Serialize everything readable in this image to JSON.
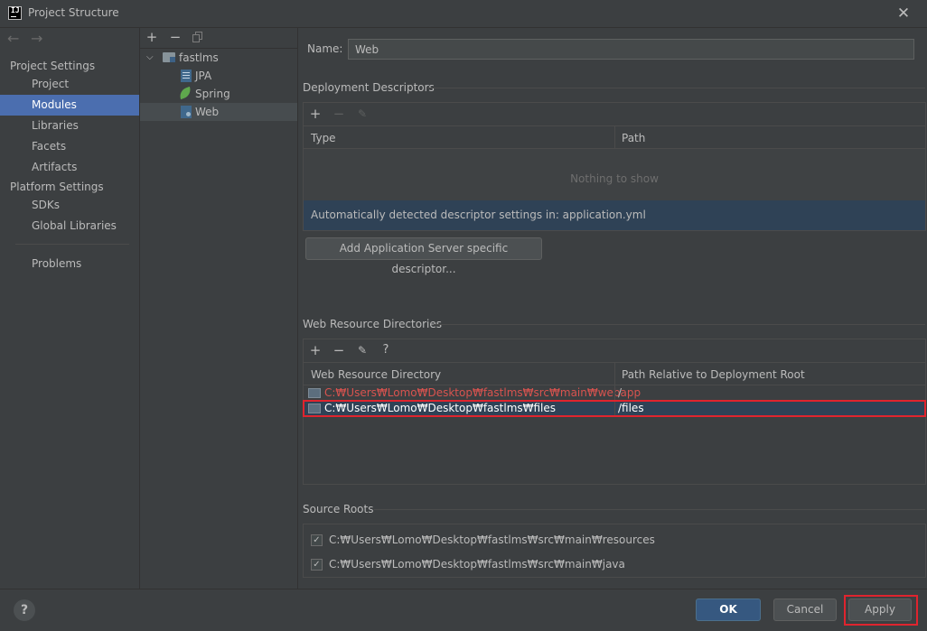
{
  "window": {
    "title": "Project Structure"
  },
  "nav": {
    "project_settings_header": "Project Settings",
    "project_settings_items": [
      "Project",
      "Modules",
      "Libraries",
      "Facets",
      "Artifacts"
    ],
    "platform_settings_header": "Platform Settings",
    "platform_settings_items": [
      "SDKs",
      "Global Libraries"
    ],
    "problems": "Problems",
    "selected": "Modules"
  },
  "tree": {
    "root": "fastlms",
    "children": [
      "JPA",
      "Spring",
      "Web"
    ],
    "selected": "Web"
  },
  "editor": {
    "name_label": "Name:",
    "name_value": "Web",
    "deployment": {
      "title": "Deployment Descriptors",
      "col_type": "Type",
      "col_path": "Path",
      "empty_text": "Nothing to show",
      "info": "Automatically detected descriptor settings in: application.yml",
      "add_button": "Add Application Server specific descriptor..."
    },
    "web_resources": {
      "title": "Web Resource Directories",
      "col_dir": "Web Resource Directory",
      "col_path": "Path Relative to Deployment Root",
      "rows": [
        {
          "dir": "C:₩Users₩Lomo₩Desktop₩fastlms₩src₩main₩webapp",
          "path": "/"
        },
        {
          "dir": "C:₩Users₩Lomo₩Desktop₩fastlms₩files",
          "path": "/files"
        }
      ]
    },
    "source_roots": {
      "title": "Source Roots",
      "items": [
        {
          "path": "C:₩Users₩Lomo₩Desktop₩fastlms₩src₩main₩resources",
          "checked": true
        },
        {
          "path": "C:₩Users₩Lomo₩Desktop₩fastlms₩src₩main₩java",
          "checked": true
        }
      ]
    }
  },
  "footer": {
    "help": "?",
    "ok": "OK",
    "cancel": "Cancel",
    "apply": "Apply"
  },
  "colors": {
    "accent": "#4b6eaf",
    "highlight": "#e0242e",
    "missing_path": "#d9534f"
  }
}
